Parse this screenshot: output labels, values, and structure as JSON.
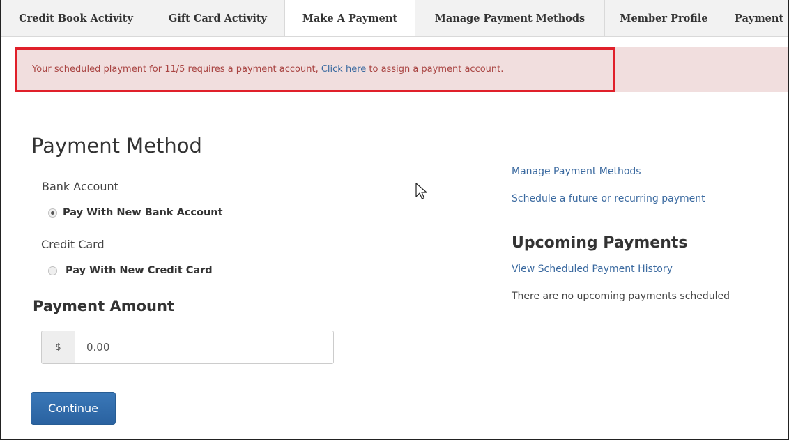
{
  "tabs": [
    {
      "label": "Credit Book Activity"
    },
    {
      "label": "Gift Card Activity"
    },
    {
      "label": "Make A Payment"
    },
    {
      "label": "Manage Payment Methods"
    },
    {
      "label": "Member Profile"
    },
    {
      "label": "Payment"
    }
  ],
  "alert": {
    "text_before": "Your scheduled playment for 11/5 requires a payment account,",
    "link_text": "Click here",
    "text_after": "to assign a payment account.",
    "highlight_color": "#e0202a",
    "background_color": "#f1dede"
  },
  "payment_method": {
    "title": "Payment Method",
    "bank_account_label": "Bank Account",
    "bank_option_label": "Pay With New Bank Account",
    "bank_option_selected": true,
    "credit_card_label": "Credit Card",
    "card_option_label": "Pay With New Credit Card",
    "card_option_selected": false
  },
  "payment_amount": {
    "title": "Payment Amount",
    "currency_symbol": "$",
    "value": "0.00"
  },
  "continue_button": {
    "label": "Continue",
    "color": "#2e6aa8"
  },
  "sidebar": {
    "manage_link": "Manage Payment Methods",
    "schedule_link": "Schedule a future or recurring payment",
    "upcoming_title": "Upcoming Payments",
    "history_link": "View Scheduled Payment History",
    "no_payments_text": "There are no upcoming payments scheduled"
  },
  "icons": {
    "cursor": "mouse-pointer-icon"
  }
}
